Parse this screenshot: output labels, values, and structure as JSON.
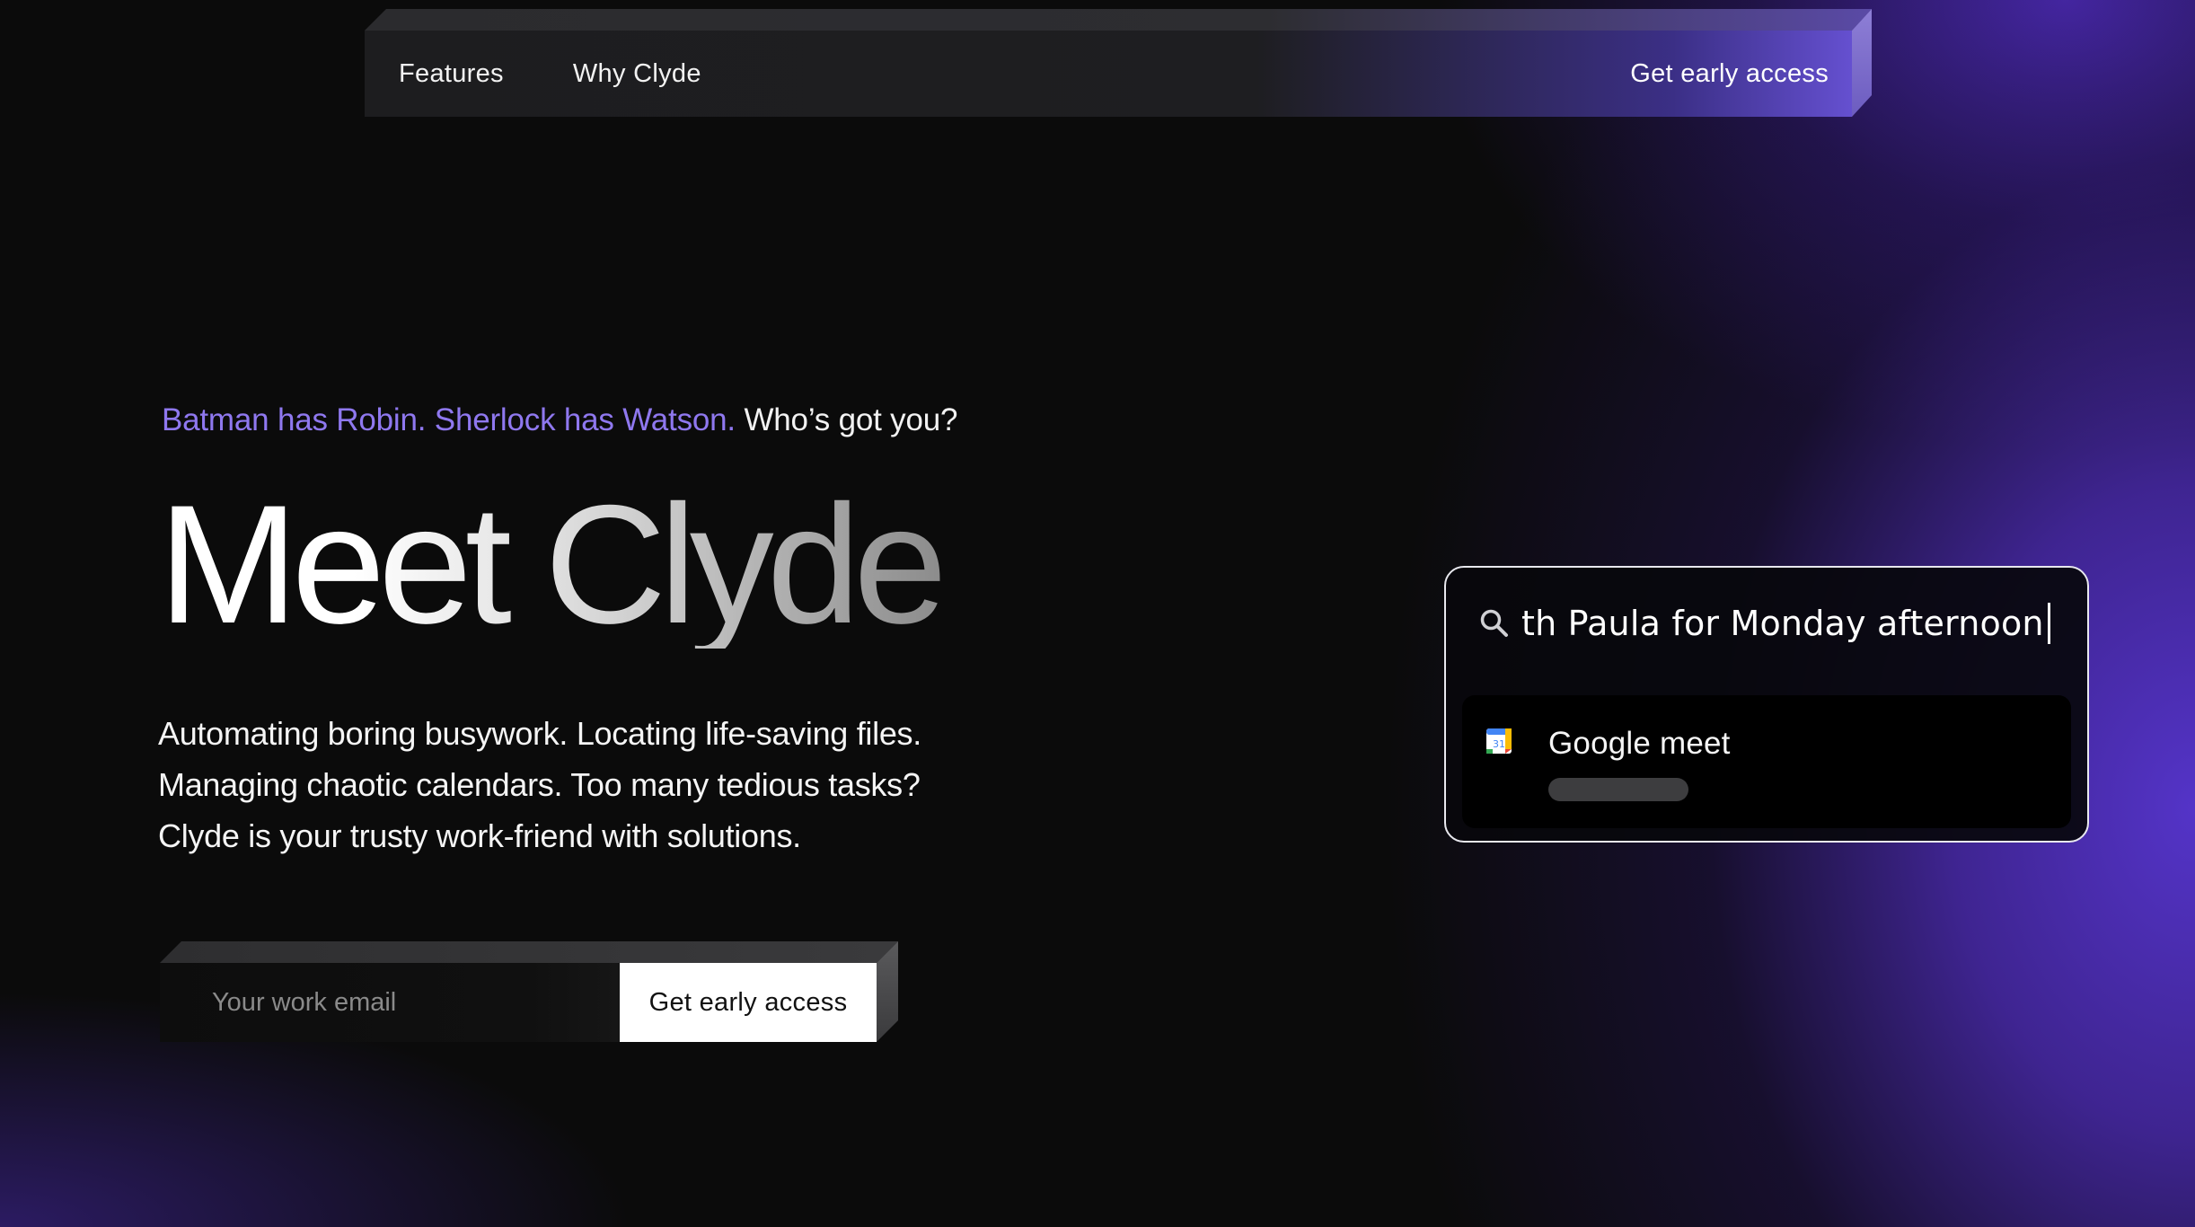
{
  "nav": {
    "links": [
      {
        "label": "Features"
      },
      {
        "label": "Why Clyde"
      }
    ],
    "cta_label": "Get early access"
  },
  "hero": {
    "tagline": {
      "part1": "Batman has Robin. Sherlock has Watson.",
      "part2": " Who’s got you?"
    },
    "title": "Meet Clyde",
    "description": [
      "Automating boring busywork. Locating life-saving files.",
      "Managing chaotic calendars. Too many tedious tasks?",
      "Clyde is your trusty work-friend with solutions."
    ]
  },
  "signup": {
    "email_placeholder": "Your work email",
    "email_value": "",
    "button_label": "Get early access"
  },
  "search_card": {
    "query": "th Paula for Monday afternoon",
    "search_icon": "search-icon",
    "result": {
      "icon": "google-calendar-icon",
      "title": "Google meet"
    }
  },
  "colors": {
    "accent_purple": "#8f78ef",
    "gradient_purple": "#5836d2",
    "background": "#0b0b0b",
    "button_bg": "#ffffff"
  }
}
